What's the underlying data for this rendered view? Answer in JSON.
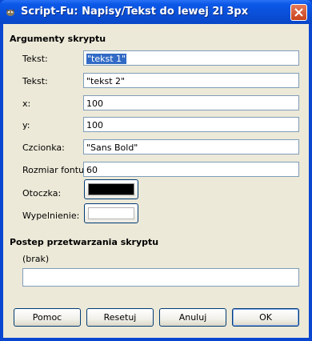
{
  "window": {
    "title": "Script-Fu: Napisy/Tekst do lewej 2l 3px"
  },
  "args": {
    "section": "Argumenty skryptu",
    "fields": [
      {
        "label": "Tekst:",
        "value": "\"tekst 1\""
      },
      {
        "label": "Tekst:",
        "value": "\"tekst 2\""
      },
      {
        "label": "x:",
        "value": "100"
      },
      {
        "label": "y:",
        "value": "100"
      },
      {
        "label": "Czcionka:",
        "value": "\"Sans Bold\""
      },
      {
        "label": "Rozmiar fontu:",
        "value": "60"
      }
    ],
    "outline": {
      "label": "Otoczka:",
      "color": "#000000"
    },
    "fill": {
      "label": "Wypelnienie:",
      "color": "#ffffff"
    }
  },
  "progress": {
    "section": "Postep przetwarzania skryptu",
    "status": "(brak)"
  },
  "buttons": {
    "help": "Pomoc",
    "reset": "Resetuj",
    "cancel": "Anuluj",
    "ok": "OK"
  }
}
